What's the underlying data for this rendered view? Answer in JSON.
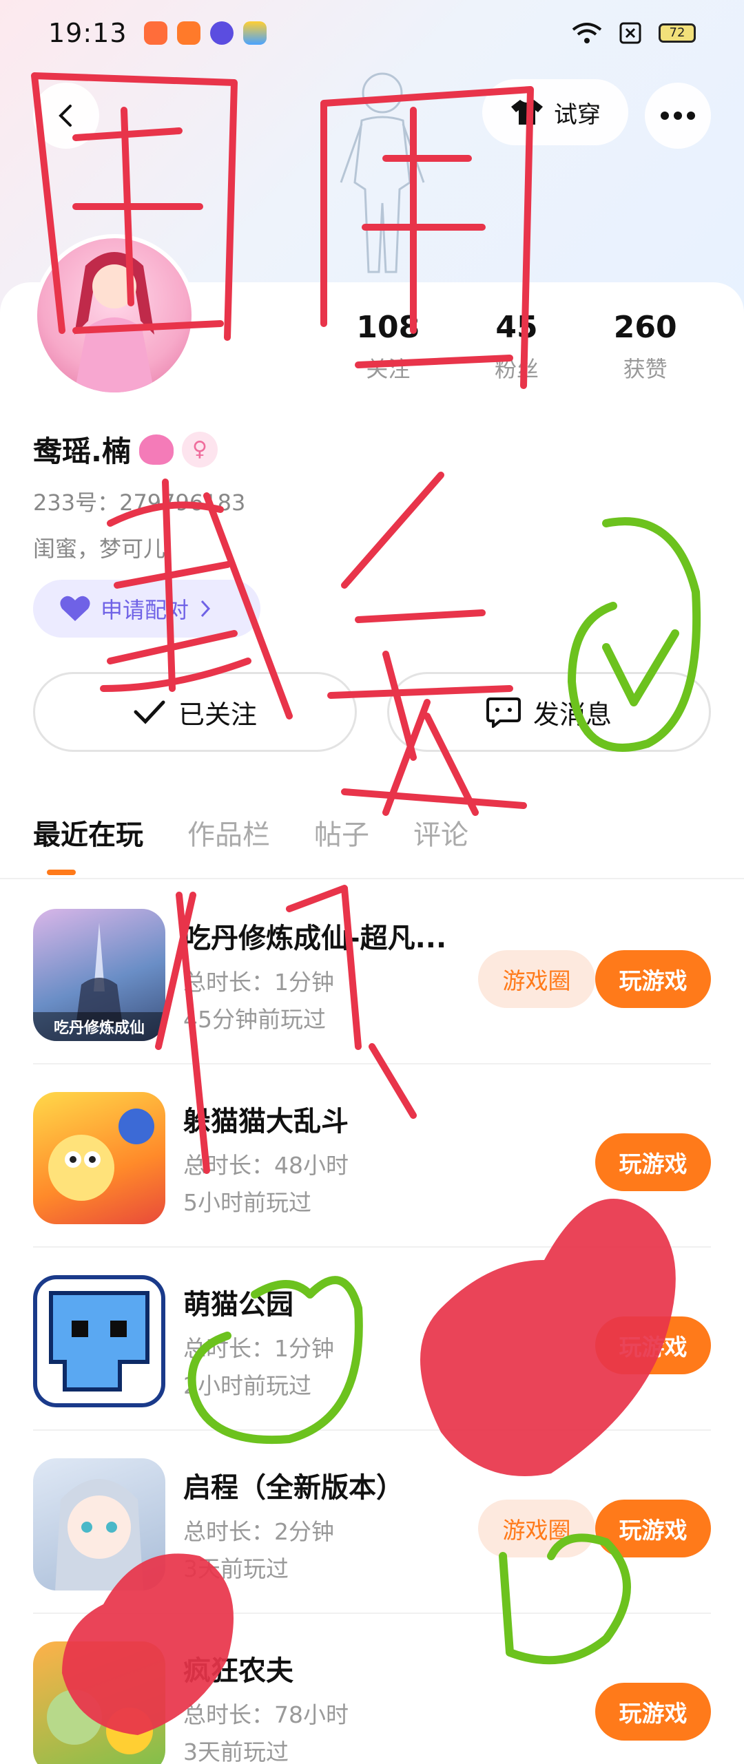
{
  "status_bar": {
    "time": "19:13",
    "battery": "72"
  },
  "header": {
    "try_on_label": "试穿"
  },
  "profile": {
    "name": "鸯瑶.楠",
    "gender_symbol": "♀",
    "id_text": "233号：279796183",
    "bio": "闺蜜，梦可儿",
    "pair_label": "申请配对"
  },
  "stats": [
    {
      "value": "108",
      "label": "关注"
    },
    {
      "value": "45",
      "label": "粉丝"
    },
    {
      "value": "260",
      "label": "获赞"
    }
  ],
  "actions": {
    "followed_label": "已关注",
    "message_label": "发消息"
  },
  "tabs": [
    "最近在玩",
    "作品栏",
    "帖子",
    "评论"
  ],
  "games": [
    {
      "title": "吃丹修炼成仙-超凡...",
      "duration": "总时长：1分钟",
      "last_played": "45分钟前玩过",
      "circle_label": "游戏圈",
      "play_label": "玩游戏",
      "icon_caption": "吃丹修炼成仙"
    },
    {
      "title": "躲猫猫大乱斗",
      "duration": "总时长：48小时",
      "last_played": "5小时前玩过",
      "circle_label": "",
      "play_label": "玩游戏",
      "icon_caption": ""
    },
    {
      "title": "萌猫公园",
      "duration": "总时长：1分钟",
      "last_played": "2小时前玩过",
      "circle_label": "",
      "play_label": "玩游戏",
      "icon_caption": ""
    },
    {
      "title": "启程（全新版本）",
      "duration": "总时长：2分钟",
      "last_played": "3天前玩过",
      "circle_label": "游戏圈",
      "play_label": "玩游戏",
      "icon_caption": ""
    },
    {
      "title": "疯狂农夫",
      "duration": "总时长：78小时",
      "last_played": "3天前玩过",
      "circle_label": "",
      "play_label": "玩游戏",
      "icon_caption": ""
    }
  ],
  "colors": {
    "accent_orange": "#ff7a1a",
    "pair_purple": "#6f62e6",
    "scribble_red": "#e8344a",
    "scribble_green": "#6cc21e"
  },
  "icons": [
    "back-arrow-icon",
    "tshirt-icon",
    "more-dots-icon",
    "heart-icon",
    "chevron-right-icon",
    "check-icon",
    "message-bubble-icon",
    "wifi-icon",
    "sim-icon"
  ]
}
